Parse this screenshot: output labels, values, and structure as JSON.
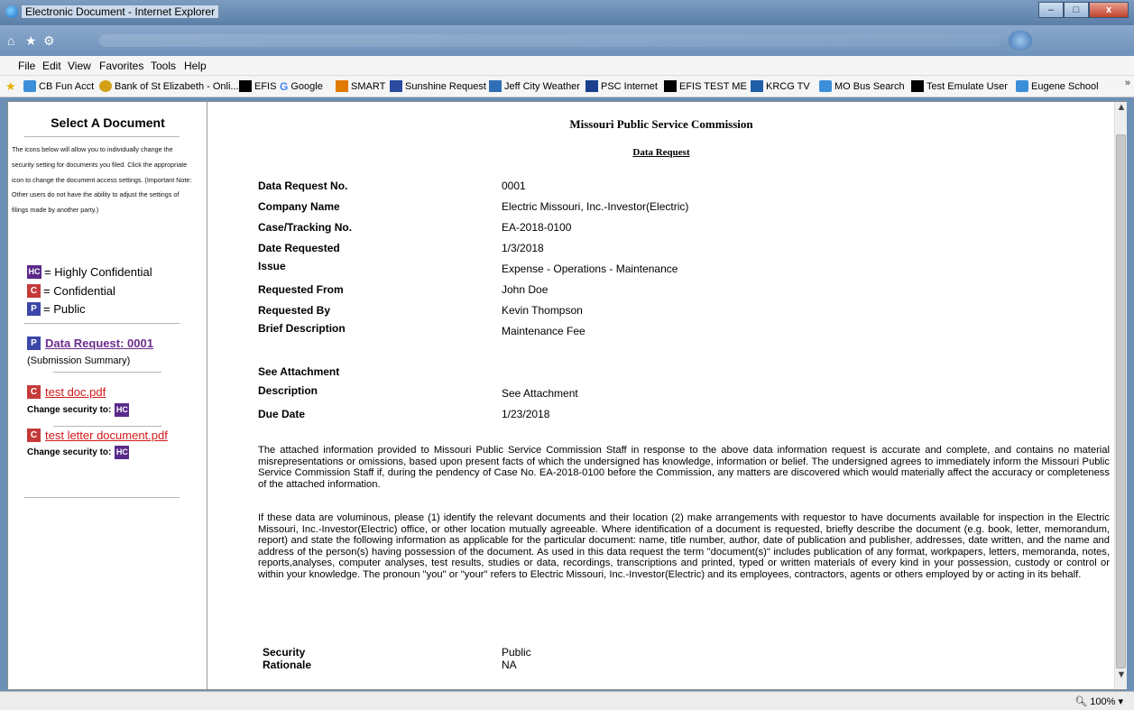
{
  "window": {
    "title": "Electronic Document - Internet Explorer",
    "controls": {
      "minimize": "–",
      "maximize": "□",
      "close": "x"
    }
  },
  "nav": {
    "home": "⌂",
    "favorites": "★",
    "tools": "⚙"
  },
  "menu": [
    "File",
    "Edit",
    "View",
    "Favorites",
    "Tools",
    "Help"
  ],
  "favorites": [
    {
      "label": "CB Fun Acct",
      "icon": "ie-page-icon",
      "color": "#3b8ed8"
    },
    {
      "label": "Bank of St Elizabeth - Onli...",
      "icon": "bank-icon",
      "color": "#d4a017"
    },
    {
      "label": "EFIS",
      "icon": "black-square-icon",
      "color": "#000000"
    },
    {
      "label": "Google",
      "icon": "google-icon",
      "color": "#4285f4"
    },
    {
      "label": "SMART",
      "icon": "smart-icon",
      "color": "#e07a00"
    },
    {
      "label": "Sunshine Request",
      "icon": "sunshine-icon",
      "color": "#2b4aa0"
    },
    {
      "label": "Jeff City Weather",
      "icon": "weather-icon",
      "color": "#2f6fb5"
    },
    {
      "label": "PSC Internet",
      "icon": "psc-icon",
      "color": "#1a3f8f"
    },
    {
      "label": "EFIS TEST ME",
      "icon": "black-square-icon",
      "color": "#000000"
    },
    {
      "label": "KRCG TV",
      "icon": "tv-icon",
      "color": "#1f5fa8"
    },
    {
      "label": "MO Bus Search",
      "icon": "ie-page-icon",
      "color": "#3b8ed8"
    },
    {
      "label": "Test Emulate User",
      "icon": "black-square-icon",
      "color": "#000000"
    },
    {
      "label": "Eugene School",
      "icon": "ie-page-icon",
      "color": "#3b8ed8"
    }
  ],
  "sidebar": {
    "title": "Select A Document",
    "instructions": "The icons below will allow you to individually change the security setting for documents you filed. Click the appropriate icon to change the document access settings. (Important Note: Other users do not have the ability to adjust the settings of filings made by another party.)",
    "legend": [
      {
        "badge": "HC",
        "label": "= Highly Confidential"
      },
      {
        "badge": "C",
        "label": "= Confidential"
      },
      {
        "badge": "P",
        "label": "= Public"
      }
    ],
    "data_request": {
      "badge": "P",
      "label": "Data Request: 0001",
      "note": "(Submission Summary)"
    },
    "documents": [
      {
        "badge": "C",
        "name": "test doc.pdf",
        "change_label": "Change security to:",
        "change_badge": "HC"
      },
      {
        "badge": "C",
        "name": "test letter document.pdf",
        "change_label": "Change security to:",
        "change_badge": "HC"
      }
    ]
  },
  "document": {
    "title": "Missouri Public Service Commission",
    "subtitle": "Data Request",
    "fields": [
      {
        "label": "Data Request No.",
        "value": "0001"
      },
      {
        "label": "Company Name",
        "value": "Electric Missouri, Inc.-Investor(Electric)"
      },
      {
        "label": "Case/Tracking No.",
        "value": "EA-2018-0100"
      },
      {
        "label": "Date Requested",
        "value": "1/3/2018"
      },
      {
        "label": "Issue",
        "value": "Expense - Operations - Maintenance"
      },
      {
        "label": "Requested From",
        "value": "John Doe"
      },
      {
        "label": "Requested By",
        "value": "Kevin Thompson"
      },
      {
        "label": "Brief Description",
        "value": "Maintenance Fee"
      }
    ],
    "see_attachment": "See Attachment",
    "fields2": [
      {
        "label": "Description",
        "value": "See Attachment"
      },
      {
        "label": "Due Date",
        "value": "1/23/2018"
      }
    ],
    "paragraph1": "The attached information provided to Missouri Public Service Commission Staff in response to the above data information request is accurate and complete, and contains no material misrepresentations or omissions, based upon present facts of which the undersigned has knowledge, information or belief. The undersigned agrees to immediately inform the Missouri Public Service Commission Staff if, during the pendency of Case No. EA-2018-0100 before the Commission, any matters are discovered which would materially affect the accuracy or completeness of the attached information.",
    "paragraph2": "If these data are voluminous, please (1) identify the relevant documents and their location (2) make arrangements with requestor to have documents available for inspection in the Electric Missouri, Inc.-Investor(Electric) office, or other location mutually agreeable. Where identification of a document is requested, briefly describe the document (e.g. book, letter, memorandum, report) and state the following information as applicable for the particular document: name, title number, author, date of publication and publisher, addresses, date written, and the name and address of the person(s) having possession of the document. As used in this data request the term \"document(s)\" includes publication of any format, workpapers, letters, memoranda, notes, reports,analyses, computer analyses, test results, studies or data, recordings, transcriptions and printed, typed or written materials of every kind in your possession, custody or control or within your knowledge. The pronoun \"you\" or \"your\" refers to Electric Missouri, Inc.-Investor(Electric) and its employees, contractors, agents or others employed by or acting in its behalf.",
    "security_label": "Security",
    "security_value": "Public",
    "rationale_label": "Rationale",
    "rationale_value": "NA"
  },
  "status": {
    "zoom": "100%"
  }
}
